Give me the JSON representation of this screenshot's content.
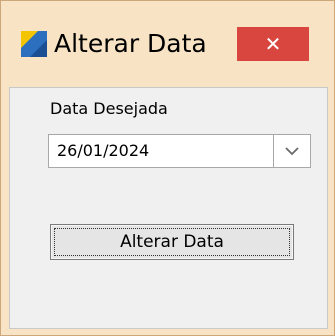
{
  "window": {
    "title": "Alterar Data",
    "close_symbol": "✕",
    "icon": "app-logo-icon"
  },
  "form": {
    "date_label": "Data Desejada",
    "date_value": "26/01/2024",
    "dropdown_icon": "chevron-down-icon",
    "submit_label": "Alterar Data"
  },
  "colors": {
    "titlebar": "#f8e4c4",
    "close_button": "#d9453f",
    "client_area": "#f0f0f0",
    "icon_yellow": "#f2c500",
    "icon_blue": "#2b6fbe"
  }
}
